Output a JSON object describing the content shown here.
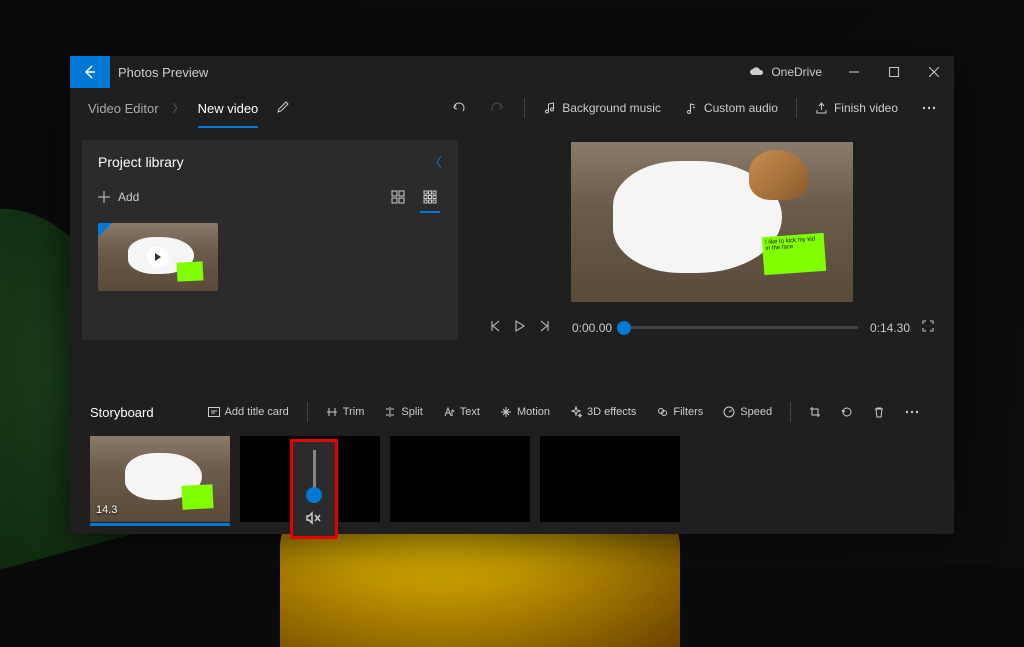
{
  "titlebar": {
    "app_title": "Photos Preview",
    "onedrive_label": "OneDrive"
  },
  "tabs": {
    "video_editor": "Video Editor",
    "new_video": "New video"
  },
  "toolbar": {
    "background_music": "Background music",
    "custom_audio": "Custom audio",
    "finish_video": "Finish video"
  },
  "library": {
    "title": "Project library",
    "add_label": "Add"
  },
  "playback": {
    "current_time": "0:00.00",
    "total_time": "0:14.30"
  },
  "storyboard": {
    "title": "Storyboard",
    "add_title_card": "Add title card",
    "trim": "Trim",
    "split": "Split",
    "text_btn": "Text",
    "motion": "Motion",
    "threeD": "3D effects",
    "filters": "Filters",
    "speed": "Speed",
    "clip_duration": "14.3"
  },
  "volume": {
    "muted_aria": "Muted"
  }
}
